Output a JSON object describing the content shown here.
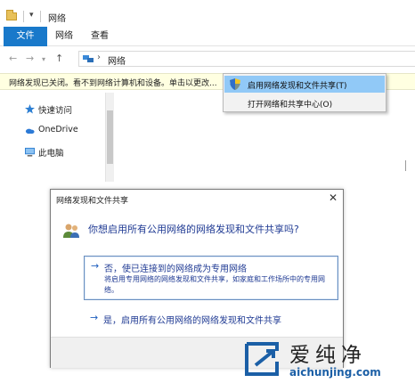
{
  "explorer": {
    "window_title": "网络",
    "ribbon_tabs": {
      "file": "文件",
      "network": "网络",
      "view": "查看"
    },
    "address": {
      "path": "网络"
    },
    "infobar": {
      "text": "网络发现已关闭。看不到网络计算机和设备。单击以更改..."
    },
    "sidebar": [
      {
        "label": "快速访问",
        "icon": "star-icon"
      },
      {
        "label": "OneDrive",
        "icon": "cloud-icon"
      },
      {
        "label": "此电脑",
        "icon": "computer-icon"
      }
    ],
    "context_menu": [
      {
        "label": "启用网络发现和文件共享(T)",
        "icon": "uac-shield-icon"
      },
      {
        "label": "打开网络和共享中心(O)"
      }
    ]
  },
  "dialog": {
    "title": "网络发现和文件共享",
    "question": "你想启用所有公用网络的网络发现和文件共享吗?",
    "option_no": {
      "title": "否，使已连接到的网络成为专用网络",
      "description": "将启用专用网络的网络发现和文件共享，如家庭和工作场所中的专用网络。"
    },
    "option_yes": {
      "title": "是，启用所有公用网络的网络发现和文件共享"
    }
  },
  "watermark": {
    "brand": "爱纯净",
    "domain": "aichunjing.com"
  },
  "colors": {
    "accent": "#1979ca",
    "infobar": "#ffffe1",
    "menu_highlight": "#91c9f7",
    "dialog_link": "#1f3a93"
  }
}
